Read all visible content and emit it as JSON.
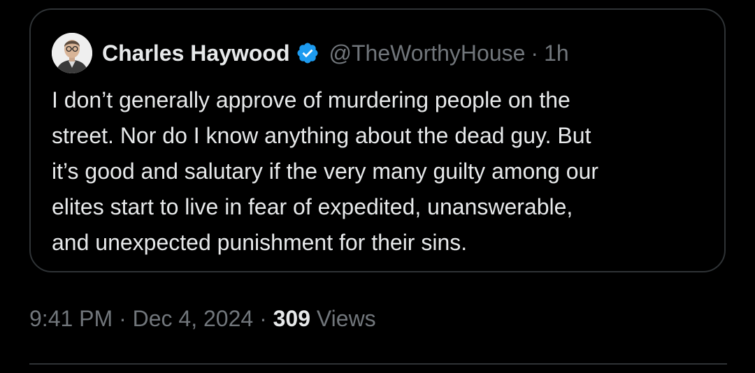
{
  "quote": {
    "author_name": "Charles Haywood",
    "author_handle": "@TheWorthyHouse",
    "separator": "·",
    "relative_time": "1h",
    "text_lines": [
      "I don’t generally approve of murdering people on the",
      "street. Nor do I know anything about the dead guy. But",
      "it’s good and salutary if the very many guilty among our",
      "elites start to live in fear of expedited, unanswerable,",
      "and unexpected punishment for their sins."
    ],
    "avatar_icon": "avatar-photo",
    "verified_icon": "verified-badge-icon"
  },
  "meta": {
    "time": "9:41 PM",
    "sep1": "·",
    "date": "Dec 4, 2024",
    "sep2": "·",
    "views_count": "309",
    "views_label": "Views"
  },
  "colors": {
    "background": "#000000",
    "text_primary": "#e7e9ea",
    "text_secondary": "#71767b",
    "border": "#2f3336",
    "verified_blue": "#1d9bf0"
  }
}
